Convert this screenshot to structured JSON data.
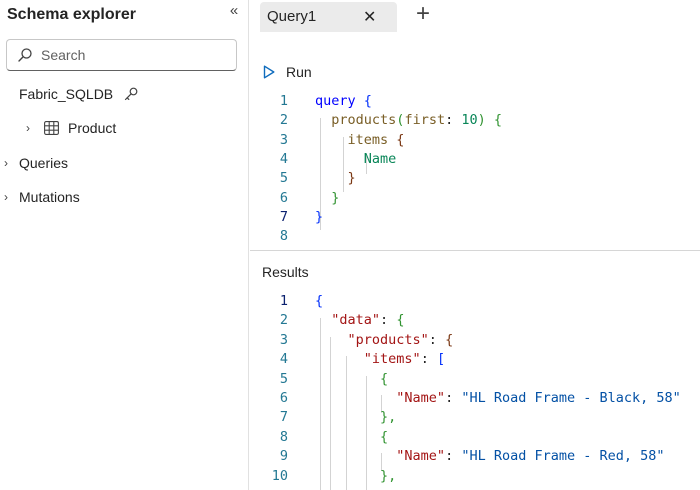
{
  "sidebar": {
    "title": "Schema explorer",
    "collapse_icon": "«",
    "search_placeholder": "Search",
    "tree": {
      "database": "Fabric_SQLDB",
      "product": "Product",
      "queries": "Queries",
      "mutations": "Mutations"
    }
  },
  "tabs": [
    {
      "label": "Query1",
      "close": "✕"
    }
  ],
  "add_tab": "+",
  "run_label": "Run",
  "results_title": "Results",
  "query_lines": [
    "1",
    "2",
    "3",
    "4",
    "5",
    "6",
    "7",
    "8"
  ],
  "query_code": {
    "l1_kw": "query",
    "l1_br": "{",
    "l2_fn": "products",
    "l2_open": "(",
    "l2_arg": "first",
    "l2_colon": ":",
    "l2_num": "10",
    "l2_close": ")",
    "l2_br": "{",
    "l3_field": "items",
    "l3_br": "{",
    "l4_field": "Name",
    "l5_br": "}",
    "l6_br": "}",
    "l7_br": "}"
  },
  "result_lines": [
    "1",
    "2",
    "3",
    "4",
    "5",
    "6",
    "7",
    "8",
    "9",
    "10"
  ],
  "result_code": {
    "l1": "{",
    "l2_key": "\"data\"",
    "l2_br": "{",
    "l3_key": "\"products\"",
    "l3_br": "{",
    "l4_key": "\"items\"",
    "l4_br": "[",
    "l5_br": "{",
    "l6_key": "\"Name\"",
    "l6_val": "\"HL Road Frame - Black, 58\"",
    "l7_br": "},",
    "l8_br": "{",
    "l9_key": "\"Name\"",
    "l9_val": "\"HL Road Frame - Red, 58\"",
    "l10_br": "},"
  },
  "colors": {
    "line_number": "#237893",
    "keyword": "#0000ff",
    "string": "#0451a5",
    "json_key": "#a31515"
  }
}
